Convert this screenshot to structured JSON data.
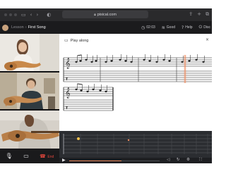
{
  "browser": {
    "url": "pisical.com",
    "lock_icon": "lock-icon",
    "left_icons": [
      "back-icon",
      "forward-icon",
      "shield-icon"
    ],
    "right_icons": [
      "share-icon",
      "new-tab-icon",
      "tabs-icon"
    ]
  },
  "header": {
    "breadcrumb_parent": "Lesson",
    "breadcrumb_separator": "›",
    "breadcrumb_current": "First Song",
    "timer": "02:03",
    "connection": "Good",
    "help": "Help",
    "last_item": "Disc"
  },
  "score": {
    "play_along_label": "Play along"
  },
  "controls": {
    "end_label": "End"
  },
  "colors": {
    "accent": "#e0463c",
    "playhead": "#f08a5d",
    "fret_marker": "#f2c14e"
  }
}
